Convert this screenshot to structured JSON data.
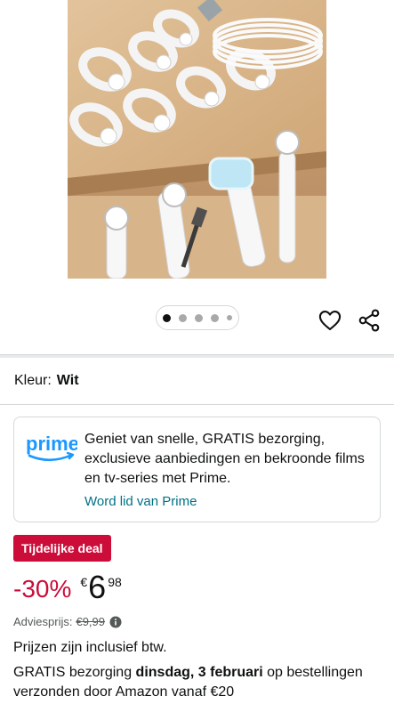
{
  "gallery": {
    "image_alt": "Witte siliconen kabelbinders",
    "dots": 5,
    "active_dot": 0
  },
  "color": {
    "label": "Kleur:",
    "value": "Wit"
  },
  "prime": {
    "logo_text": "prime",
    "text": "Geniet van snelle, GRATIS bezorging, exclusieve aanbiedingen en bekroonde films en tv-series met Prime.",
    "link": "Word lid van Prime"
  },
  "deal": {
    "badge": "Tijdelijke deal",
    "discount": "-30%",
    "currency": "€",
    "whole": "6",
    "fraction": "98"
  },
  "list_price": {
    "label": "Adviesprijs:",
    "value": "€9,99"
  },
  "vat_note": "Prijzen zijn inclusief btw.",
  "delivery": {
    "prefix": "GRATIS bezorging",
    "date": "dinsdag, 3 februari",
    "suffix": "op bestellingen verzonden door Amazon vanaf €20"
  },
  "colors": {
    "deal_red": "#cc0c39",
    "link_teal": "#007185",
    "prime_blue": "#1a98ff"
  }
}
